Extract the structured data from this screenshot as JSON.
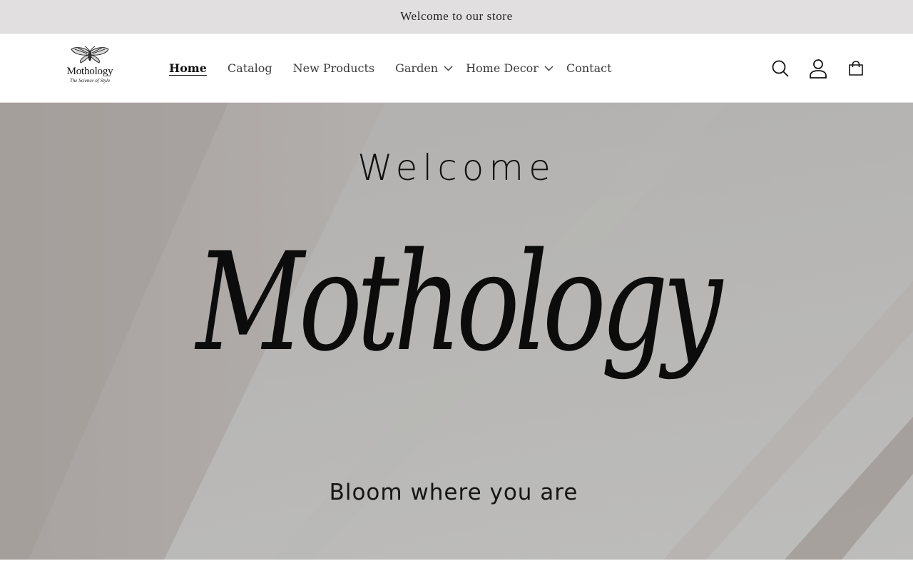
{
  "announcement": {
    "text": "Welcome to our store"
  },
  "header": {
    "logo": {
      "name": "Mothology",
      "tagline": "The Science of Style",
      "icon": "moth-icon"
    },
    "nav": [
      {
        "label": "Home",
        "active": true,
        "dropdown": false
      },
      {
        "label": "Catalog",
        "active": false,
        "dropdown": false
      },
      {
        "label": "New Products",
        "active": false,
        "dropdown": false
      },
      {
        "label": "Garden",
        "active": false,
        "dropdown": true
      },
      {
        "label": "Home Decor",
        "active": false,
        "dropdown": true
      },
      {
        "label": "Contact",
        "active": false,
        "dropdown": false
      }
    ],
    "icons": [
      "search-icon",
      "account-icon",
      "cart-icon"
    ]
  },
  "hero": {
    "welcome": "Welcome",
    "brand_script": "Mothology",
    "tagline": "Bloom where you are"
  },
  "colors": {
    "announcement_bg": "#e1dfe0",
    "hero_light": "#bdbdbb",
    "hero_shadow": "#a39d9a",
    "text": "#121212"
  }
}
